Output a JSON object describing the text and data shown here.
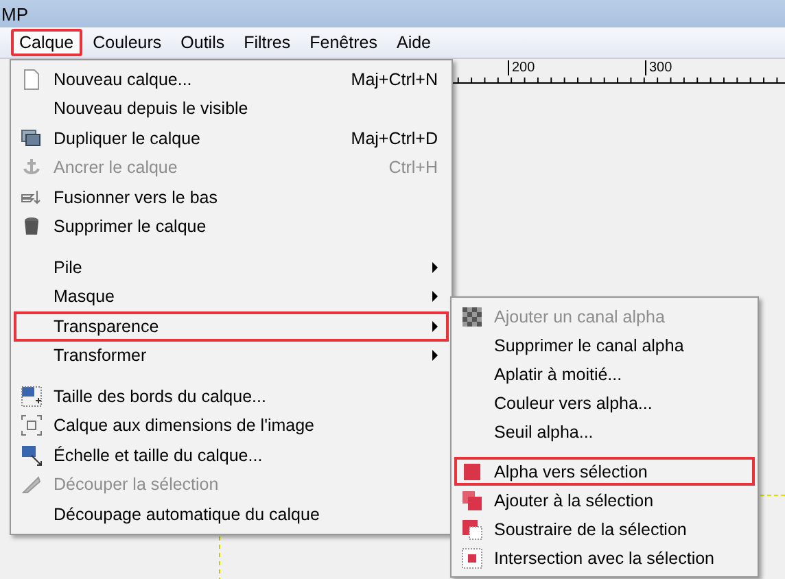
{
  "window": {
    "title": "MP"
  },
  "menubar": [
    {
      "label": "Calque",
      "selected": true,
      "highlighted": true
    },
    {
      "label": "Couleurs",
      "selected": false,
      "highlighted": false
    },
    {
      "label": "Outils",
      "selected": false,
      "highlighted": false
    },
    {
      "label": "Filtres",
      "selected": false,
      "highlighted": false
    },
    {
      "label": "Fenêtres",
      "selected": false,
      "highlighted": false
    },
    {
      "label": "Aide",
      "selected": false,
      "highlighted": false
    }
  ],
  "ruler": {
    "labels": [
      "200",
      "300"
    ]
  },
  "menu": [
    {
      "kind": "item",
      "label": "Nouveau calque...",
      "shortcut": "Maj+Ctrl+N",
      "disabled": false,
      "highlighted": false,
      "submenu": false
    },
    {
      "kind": "item",
      "label": "Nouveau depuis le visible",
      "disabled": false,
      "highlighted": false,
      "submenu": false
    },
    {
      "kind": "item",
      "label": "Dupliquer le calque",
      "shortcut": "Maj+Ctrl+D",
      "disabled": false,
      "highlighted": false,
      "submenu": false
    },
    {
      "kind": "item",
      "label": "Ancrer le calque",
      "shortcut": "Ctrl+H",
      "disabled": true,
      "highlighted": false,
      "submenu": false
    },
    {
      "kind": "item",
      "label": "Fusionner vers le bas",
      "disabled": false,
      "highlighted": false,
      "submenu": false
    },
    {
      "kind": "item",
      "label": "Supprimer le calque",
      "disabled": false,
      "highlighted": false,
      "submenu": false
    },
    {
      "kind": "separator"
    },
    {
      "kind": "item",
      "label": "Pile",
      "disabled": false,
      "highlighted": false,
      "submenu": true
    },
    {
      "kind": "item",
      "label": "Masque",
      "disabled": false,
      "highlighted": false,
      "submenu": true
    },
    {
      "kind": "item",
      "label": "Transparence",
      "disabled": false,
      "highlighted": true,
      "submenu": true
    },
    {
      "kind": "item",
      "label": "Transformer",
      "disabled": false,
      "highlighted": false,
      "submenu": true
    },
    {
      "kind": "separator"
    },
    {
      "kind": "item",
      "label": "Taille des bords du calque...",
      "disabled": false,
      "highlighted": false,
      "submenu": false
    },
    {
      "kind": "item",
      "label": "Calque aux dimensions de l'image",
      "disabled": false,
      "highlighted": false,
      "submenu": false
    },
    {
      "kind": "item",
      "label": "Échelle et taille du calque...",
      "disabled": false,
      "highlighted": false,
      "submenu": false
    },
    {
      "kind": "item",
      "label": "Découper la sélection",
      "disabled": true,
      "highlighted": false,
      "submenu": false
    },
    {
      "kind": "item",
      "label": "Découpage automatique du calque",
      "disabled": false,
      "highlighted": false,
      "submenu": false
    }
  ],
  "submenu": [
    {
      "kind": "item",
      "label": "Ajouter un canal alpha",
      "disabled": true,
      "highlighted": false
    },
    {
      "kind": "item",
      "label": "Supprimer le canal alpha",
      "disabled": false,
      "highlighted": false
    },
    {
      "kind": "item",
      "label": "Aplatir à moitié...",
      "disabled": false,
      "highlighted": false
    },
    {
      "kind": "item",
      "label": "Couleur vers alpha...",
      "disabled": false,
      "highlighted": false
    },
    {
      "kind": "item",
      "label": "Seuil alpha...",
      "disabled": false,
      "highlighted": false
    },
    {
      "kind": "separator"
    },
    {
      "kind": "item",
      "label": "Alpha vers sélection",
      "disabled": false,
      "highlighted": true
    },
    {
      "kind": "item",
      "label": "Ajouter à la sélection",
      "disabled": false,
      "highlighted": false
    },
    {
      "kind": "item",
      "label": "Soustraire de la sélection",
      "disabled": false,
      "highlighted": false
    },
    {
      "kind": "item",
      "label": "Intersection avec la sélection",
      "disabled": false,
      "highlighted": false
    }
  ]
}
